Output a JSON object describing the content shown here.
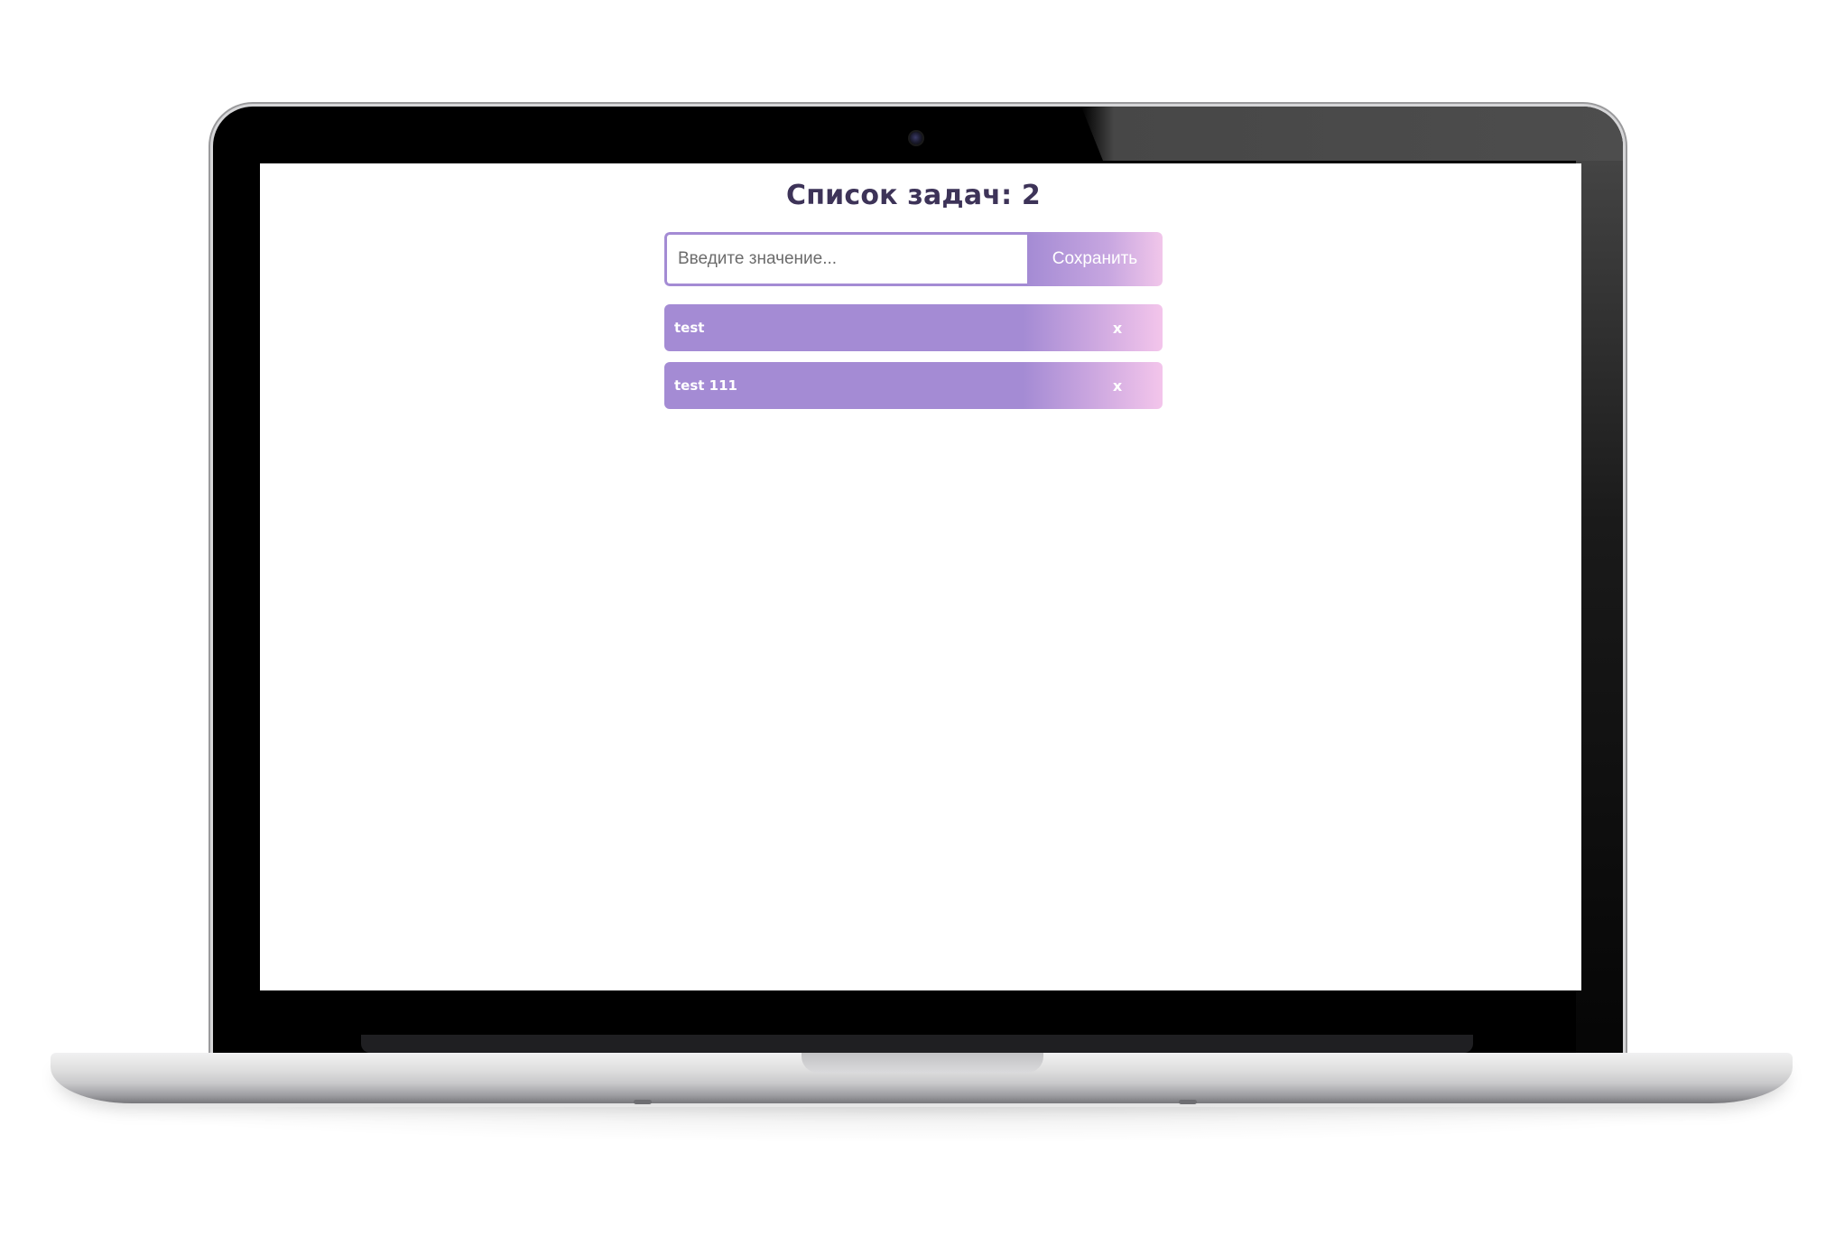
{
  "app": {
    "title": "Список задач: 2"
  },
  "form": {
    "input_value": "",
    "input_placeholder": "Введите значение...",
    "save_label": "Сохранить"
  },
  "tasks": [
    {
      "text": "test",
      "delete_label": "x"
    },
    {
      "text": "test 111",
      "delete_label": "x"
    }
  ],
  "colors": {
    "accent": "#a48bd4",
    "accent_end": "#f3c5eb",
    "title": "#3d3358"
  },
  "device": {
    "type": "laptop-mockup"
  }
}
